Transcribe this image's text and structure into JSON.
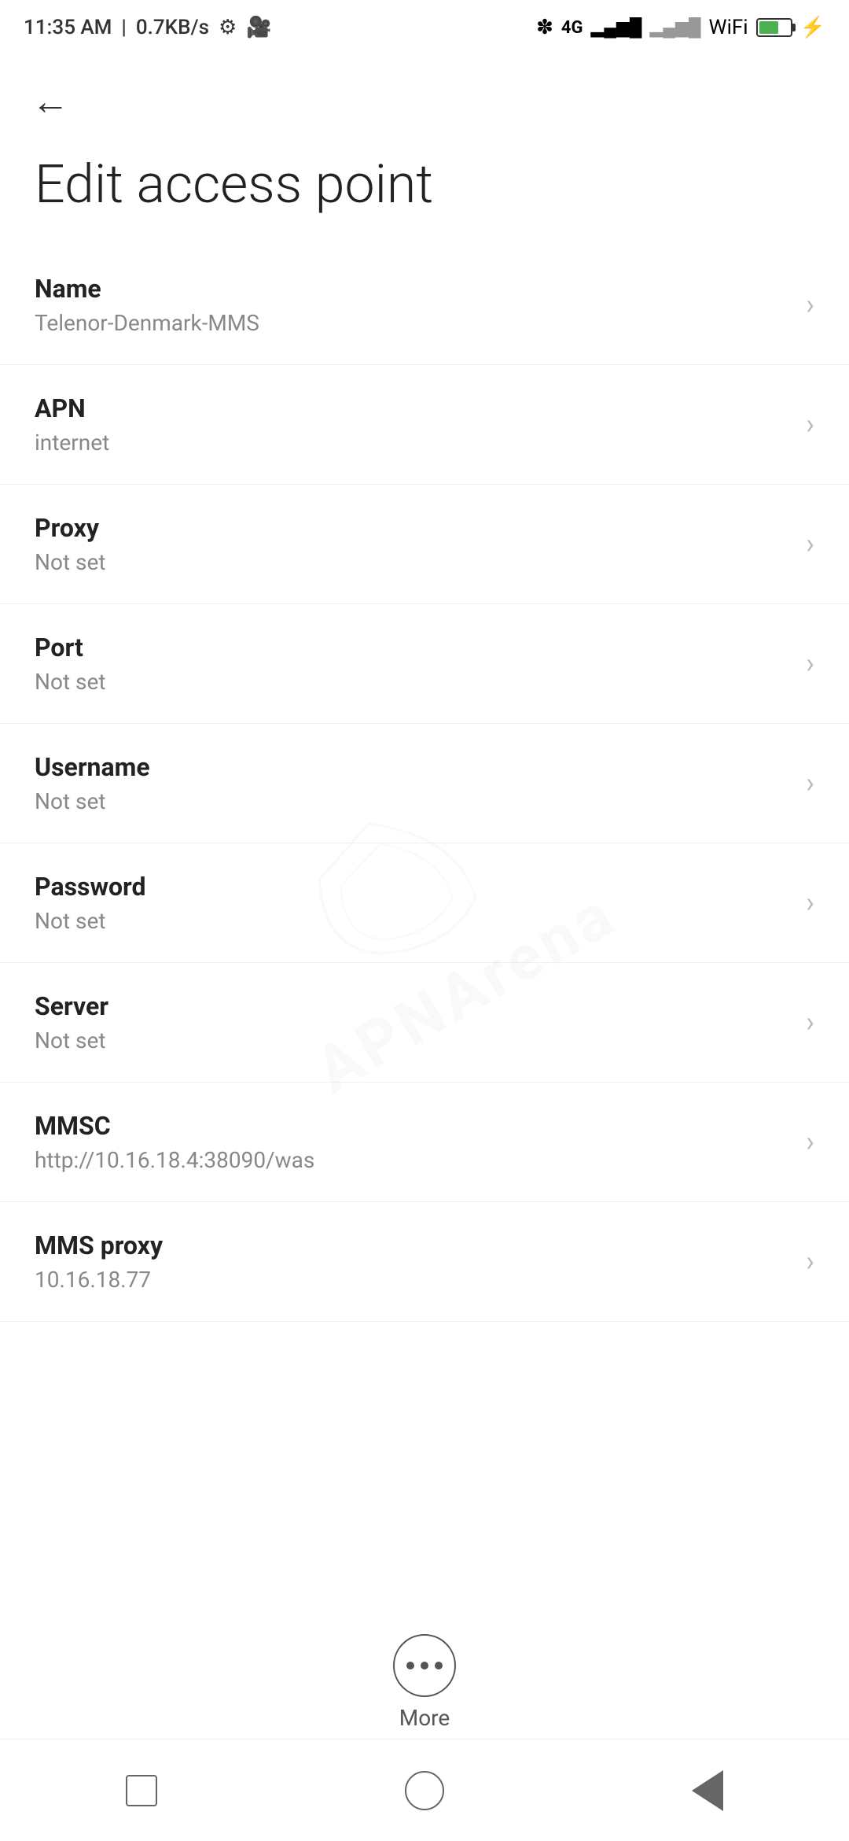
{
  "statusBar": {
    "time": "11:35 AM",
    "speed": "0.7KB/s"
  },
  "page": {
    "title": "Edit access point",
    "backLabel": "←"
  },
  "settings": [
    {
      "id": "name",
      "label": "Name",
      "value": "Telenor-Denmark-MMS"
    },
    {
      "id": "apn",
      "label": "APN",
      "value": "internet"
    },
    {
      "id": "proxy",
      "label": "Proxy",
      "value": "Not set"
    },
    {
      "id": "port",
      "label": "Port",
      "value": "Not set"
    },
    {
      "id": "username",
      "label": "Username",
      "value": "Not set"
    },
    {
      "id": "password",
      "label": "Password",
      "value": "Not set"
    },
    {
      "id": "server",
      "label": "Server",
      "value": "Not set"
    },
    {
      "id": "mmsc",
      "label": "MMSC",
      "value": "http://10.16.18.4:38090/was"
    },
    {
      "id": "mms-proxy",
      "label": "MMS proxy",
      "value": "10.16.18.77"
    }
  ],
  "more": {
    "label": "More"
  },
  "watermark": {
    "line1": "APNArena"
  }
}
